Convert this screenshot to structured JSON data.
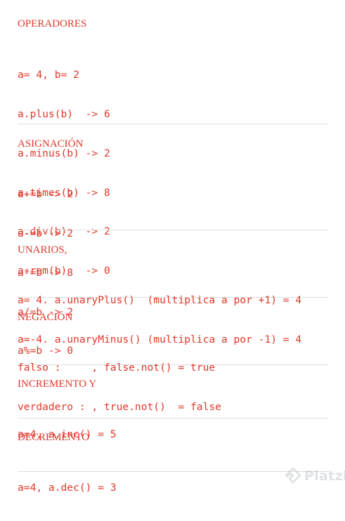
{
  "sections": [
    {
      "title": "OPERADORES",
      "lines": [
        "a= 4, b= 2",
        "a.plus(b)  -> 6",
        "a.minus(b) -> 2",
        "a.times(b) -> 8",
        "a.div(b)   -> 2",
        "a.rem(b)   -> 0"
      ]
    },
    {
      "title": "ASIGNACIÓN",
      "lines": [
        "a+=b -> 2",
        "a-=b -> 2",
        "a*=b -> 8",
        "a/=b -> 2",
        "a%=b -> 0"
      ]
    },
    {
      "title": "UNARIOS,",
      "lines": [
        "a= 4. a.unaryPlus()  (multiplica a por +1) = 4",
        "a=-4. a.unaryMinus() (multiplica a por -1) = 4"
      ]
    },
    {
      "title": "NEGACIÓN",
      "lines": [
        "falso :     , false.not() = true",
        "verdadero : , true.not()  = false"
      ]
    },
    {
      "title": "INCREMENTO Y",
      "lines": [
        "a=4, a.inc() = 5"
      ]
    },
    {
      "title": "DECREMENTO",
      "lines": [
        "a=4, a.dec() = 3"
      ]
    }
  ],
  "watermark": {
    "text": "Platzi",
    "icon": "platzi-logo-icon"
  },
  "colors": {
    "text": "#e0382a",
    "divider": "#dedede",
    "watermark": "#8a9aa5"
  }
}
